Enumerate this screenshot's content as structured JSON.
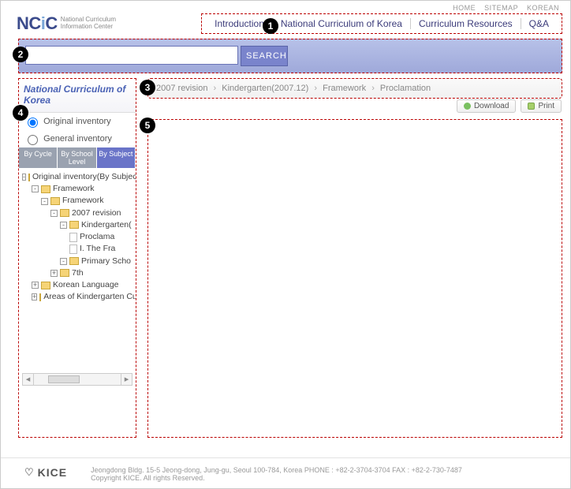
{
  "util_nav": {
    "home": "HOME",
    "sitemap": "SITEMAP",
    "korean": "KOREAN"
  },
  "logo": {
    "text_a": "NC",
    "text_i": "i",
    "text_c": "C",
    "sub1": "National Curriculum",
    "sub2": "Information Center"
  },
  "mainnav": {
    "intro": "Introduction",
    "nck": "National Curriculum of Korea",
    "cr": "Curriculum Resources",
    "qa": "Q&A"
  },
  "search": {
    "value": "",
    "placeholder": "",
    "button": "SEARCH"
  },
  "left": {
    "title": "National Curriculum of Korea",
    "radios": {
      "original": "Original inventory",
      "general": "General inventory",
      "selected": "original"
    },
    "tabs": {
      "bycycle": "By Cycle",
      "byschool": "By School Level",
      "bysubject": "By Subject"
    },
    "tree": {
      "root": "Original inventory(By Subject",
      "framework": "Framework",
      "framework2": "Framework",
      "rev2007": "2007 revision",
      "kinder": "Kindergarten(",
      "proclama": "Proclama",
      "ithefra": "I. The Fra",
      "primary": "Primary Scho",
      "seventh": "7th",
      "korean": "Korean Language",
      "areas": "Areas of Kindergarten Cu"
    }
  },
  "breadcrumb": {
    "a": "2007 revision",
    "b": "Kindergarten(2007.12)",
    "c": "Framework",
    "d": "Proclamation"
  },
  "actions": {
    "download": "Download",
    "print": "Print"
  },
  "footer": {
    "kice": "KICE",
    "addr": "Jeongdong Bldg. 15-5 Jeong-dong, Jung-gu, Seoul 100-784, Korea   PHONE : +82-2-3704-3704 FAX : +82-2-730-7487",
    "copy": "Copyright KICE. All rights Reserved."
  },
  "callouts": {
    "c1": "1",
    "c2": "2",
    "c3": "3",
    "c4": "4",
    "c5": "5"
  }
}
